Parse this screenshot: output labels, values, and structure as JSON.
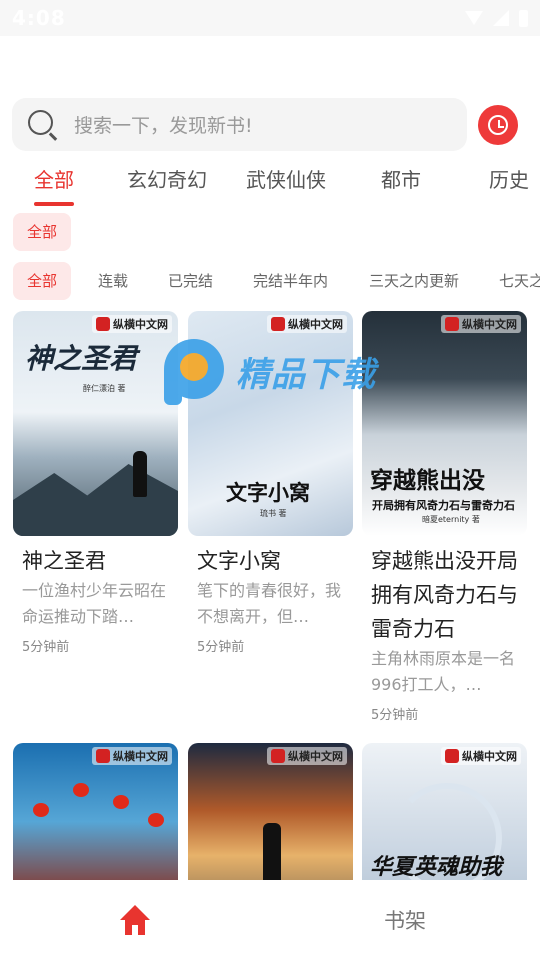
{
  "status_bar": {
    "time": "4:08"
  },
  "search": {
    "placeholder": "搜索一下，发现新书!"
  },
  "category_tabs": [
    {
      "label": "全部",
      "active": true
    },
    {
      "label": "玄幻奇幻"
    },
    {
      "label": "武侠仙侠"
    },
    {
      "label": "都市"
    },
    {
      "label": "历史"
    }
  ],
  "sub_chip": {
    "label": "全部"
  },
  "filters": [
    {
      "label": "全部",
      "active": true
    },
    {
      "label": "连载"
    },
    {
      "label": "已完结"
    },
    {
      "label": "完结半年内"
    },
    {
      "label": "三天之内更新"
    },
    {
      "label": "七天之"
    }
  ],
  "books": [
    {
      "title": "神之圣君",
      "description": "一位渔村少年云昭在命运推动下踏…",
      "time": "5分钟前",
      "cover_badge": "纵横中文网",
      "cover_title": "神之圣君",
      "cover_author": "醉仁漂泊 著"
    },
    {
      "title": "文字小窝",
      "description": "笔下的青春很好，我不想离开，但…",
      "time": "5分钟前",
      "cover_badge": "纵横中文网",
      "cover_title": "文字小窝",
      "cover_author": "琉书 著"
    },
    {
      "title": "穿越熊出没开局拥有风奇力石与雷奇力石",
      "description": "主角林雨原本是一名996打工人，…",
      "time": "5分钟前",
      "cover_badge": "纵横中文网",
      "cover_title": "穿越熊出没",
      "cover_subtitle": "开局拥有风奇力石与雷奇力石",
      "cover_author": "暗夏eternity 著"
    },
    {
      "cover_badge": "纵横中文网"
    },
    {
      "cover_badge": "纵横中文网"
    },
    {
      "cover_badge": "纵横中文网",
      "cover_title": "华夏英魂助我"
    }
  ],
  "watermark": {
    "text": "精品下载"
  },
  "bottom_nav": {
    "home_icon": "home-icon",
    "shelf_label": "书架"
  },
  "colors": {
    "accent": "#e8342f",
    "chip_bg": "#fde8e8"
  }
}
